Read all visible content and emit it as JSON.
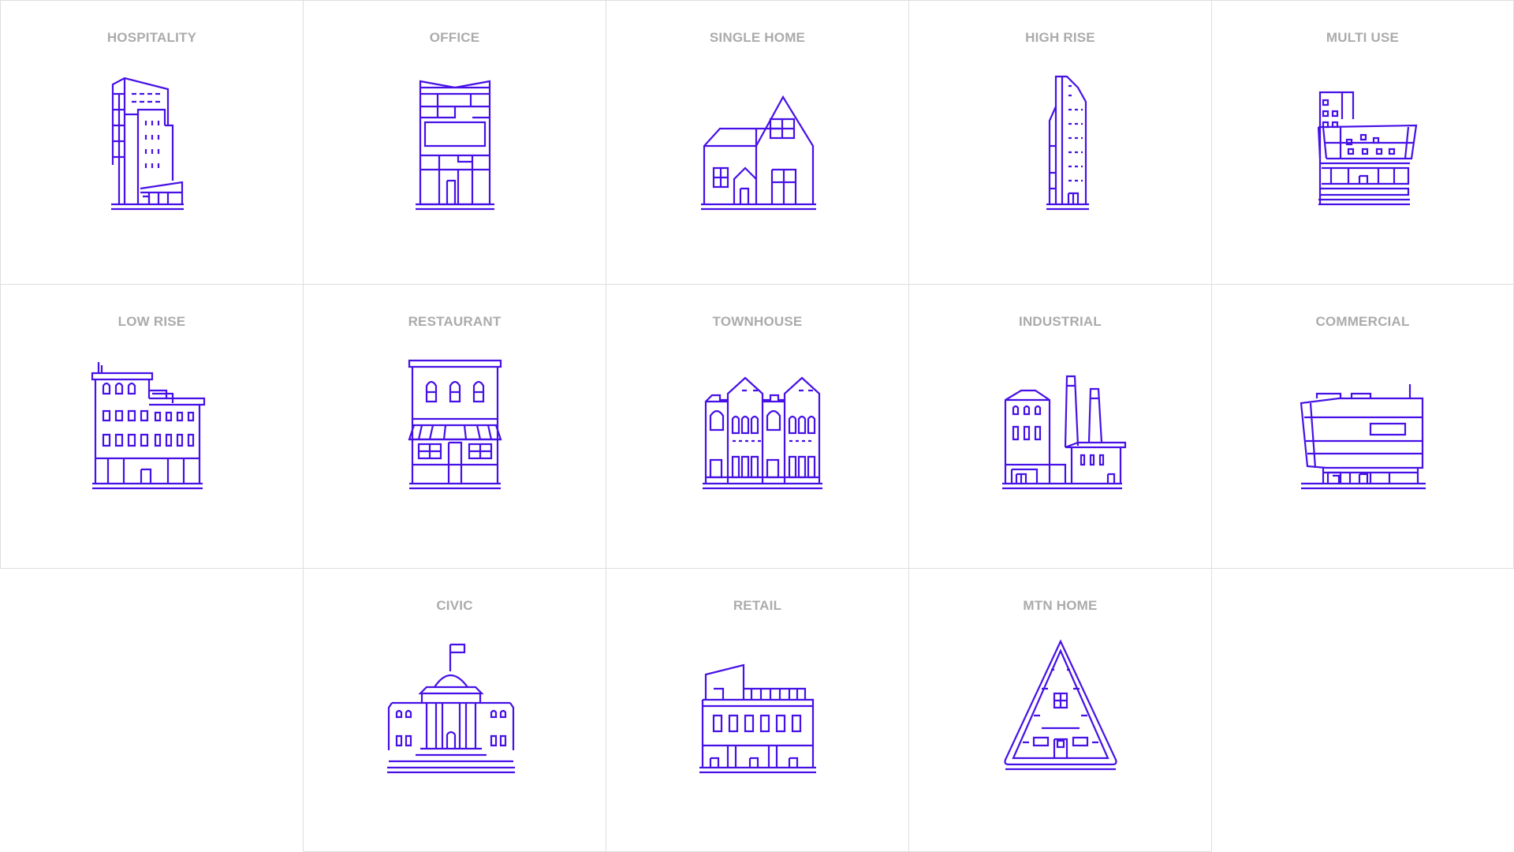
{
  "accent_color": "#4610e6",
  "label_color": "#ababab",
  "border_color": "#dedede",
  "tiles": [
    {
      "label": "HOSPITALITY",
      "icon": "hospitality-building-icon"
    },
    {
      "label": "OFFICE",
      "icon": "office-building-icon"
    },
    {
      "label": "SINGLE HOME",
      "icon": "single-home-icon"
    },
    {
      "label": "HIGH RISE",
      "icon": "high-rise-icon"
    },
    {
      "label": "MULTI USE",
      "icon": "multi-use-building-icon"
    },
    {
      "label": "LOW RISE",
      "icon": "low-rise-building-icon"
    },
    {
      "label": "RESTAURANT",
      "icon": "restaurant-icon"
    },
    {
      "label": "TOWNHOUSE",
      "icon": "townhouse-icon"
    },
    {
      "label": "INDUSTRIAL",
      "icon": "industrial-factory-icon"
    },
    {
      "label": "COMMERCIAL",
      "icon": "commercial-building-icon"
    },
    {
      "label": "CIVIC",
      "icon": "civic-building-icon"
    },
    {
      "label": "RETAIL",
      "icon": "retail-building-icon"
    },
    {
      "label": "MTN HOME",
      "icon": "mountain-home-icon"
    }
  ]
}
